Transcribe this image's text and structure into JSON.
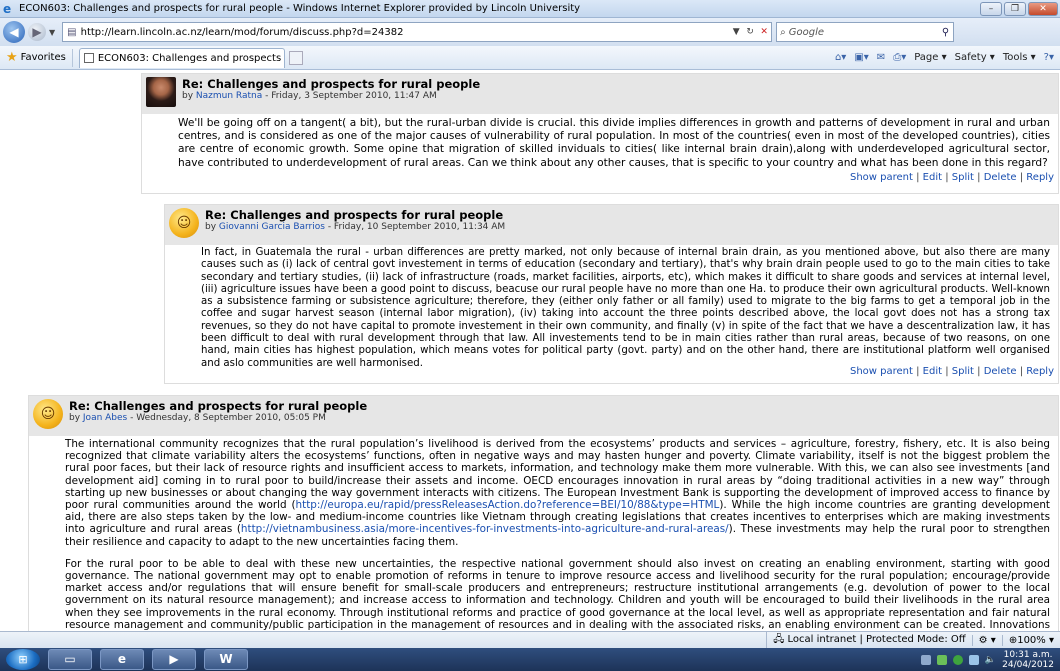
{
  "browser": {
    "window_title": "ECON603: Challenges and prospects for rural people - Windows Internet Explorer provided by Lincoln University",
    "address": "http://learn.lincoln.ac.nz/learn/mod/forum/discuss.php?d=24382",
    "search_placeholder": "Google",
    "favorites_label": "Favorites",
    "tab_title": "ECON603: Challenges and prospects for rural peo...",
    "commands": {
      "page": "Page ▾",
      "safety": "Safety ▾",
      "tools": "Tools ▾"
    }
  },
  "posts": [
    {
      "subject": "Re: Challenges and prospects for rural people",
      "by_prefix": "by ",
      "author": "Nazmun Ratna",
      "date": " - Friday, 3 September 2010, 11:47 AM",
      "paragraphs": [
        "We'll be going  off on a tangent( a bit), but the rural-urban divide is crucial. this divide implies differences in growth and patterns of development in rural and urban centres, and is considered as one of the major causes of vulnerability of rural population. In most of the countries( even in most of  the developed countries), cities are centre of economic growth. Some opine that migration of skilled inviduals to cities( like internal brain drain),along with underdeveloped agricultural sector, have contributed to underdevelopment of rural areas. Can we think about any other causes, that is specific to your country and what has been done in this regard?"
      ],
      "links": {
        "show_parent": "Show parent",
        "edit": "Edit",
        "split": "Split",
        "delete": "Delete",
        "reply": "Reply"
      }
    },
    {
      "subject": "Re: Challenges and prospects for rural people",
      "by_prefix": "by ",
      "author": "Giovanni Garcia Barrios",
      "date": " - Friday, 10 September 2010, 11:34 AM",
      "paragraphs": [
        "In fact, in Guatemala the rural - urban differences are pretty marked, not only because of internal brain drain, as you mentioned above, but also there are many causes such as (i) lack of central govt investement in terms of education (secondary and tertiary), that's why brain drain people used to go to the main cities to take secondary and tertiary studies, (ii) lack of infrastructure (roads, market facilities, airports, etc), which makes it difficult to share goods and services at internal level, (iii) agriculture  issues have been a good point to discuss, beacuse our rural people have no more than one Ha. to produce their own agricultural products. Well-known as a subsistence farming or subsistence agriculture; therefore, they (either only father or all family) used to migrate to the big farms to get a temporal job in the coffee and sugar harvest season (internal labor migration), (iv)  taking into account the three points described above, the local govt does not has a strong tax revenues, so they do not have capital to promote investement in their own community, and finally (v) in spite of the fact that we have a descentralization law, it has been difficult to deal with rural development through that law.  All investements tend to be in main cities rather than rural areas, because of two reasons, on one hand, main cities has highest population, which means votes for political party (govt. party) and on the other hand, there are institutional platform well organised and aslo communities are well harmonised."
      ],
      "links": {
        "show_parent": "Show parent",
        "edit": "Edit",
        "split": "Split",
        "delete": "Delete",
        "reply": "Reply"
      }
    },
    {
      "subject": "Re: Challenges and prospects for rural people",
      "by_prefix": "by ",
      "author": "Joan Abes",
      "date": " - Wednesday, 8 September 2010, 05:05 PM",
      "p1_a": "The international community recognizes that the rural population’s livelihood is derived from the ecosystems’ products and services – agriculture, forestry, fishery, etc. It is also being recognized that climate variability alters the ecosystems’ functions, often in negative ways and may hasten hunger and poverty. Climate variability, itself is not the biggest problem the rural poor faces, but their lack of resource rights and insufficient access to markets, information, and technology make them more vulnerable. With this, we can also see investments [and development aid] coming in to rural poor to build/increase their assets and income. OECD encourages innovation in rural areas by “doing traditional activities in a new way” through starting up new businesses or about changing the way government interacts with citizens. The European Investment Bank is supporting the development of improved access to finance by poor rural communities around the world (",
      "link1": "http://europa.eu/rapid/pressReleasesAction.do?reference=BEI/10/88&type=HTML",
      "p1_b": "). While the high income countries are granting development aid, there are also steps taken by the low- and medium-income countries like Vietnam through creating legislations that creates incentives to enterprises which are making investments into agriculture and rural areas (",
      "link2": "http://vietnambusiness.asia/more-incentives-for-investments-into-agriculture-and-rural-areas/",
      "p1_c": "). These investments may help the rural poor to strengthen their resilience and capacity to adapt to the new uncertainties facing them.",
      "p2": "For the rural poor to be able to deal with these new uncertainties, the respective national government should also invest on creating an enabling environment, starting with good governance. The national government may opt to enable promotion of reforms in tenure to improve resource access and livelihood security for the rural population; encourage/provide market access and/or regulations that will ensure benefit for small-scale producers and entrepreneurs; restructure institutional arrangements (e.g. devolution of power to the local government on its natural resource management); and increase access to information and technology. Children and youth will be encouraged to build their livelihoods in the rural area when they see improvements in the rural economy. Through institutional reforms and practice of good governance at the local level, as well as appropriate representation and fair natural resource management and community/public participation in the management of resources and in dealing with the associated risks, an enabling environment can be created. Innovations in rural"
    }
  ],
  "status": {
    "zone": "Local intranet | Protected Mode: Off",
    "zoom": "100%"
  },
  "taskbar": {
    "time": "10:31 a.m.",
    "date": "24/04/2012"
  }
}
